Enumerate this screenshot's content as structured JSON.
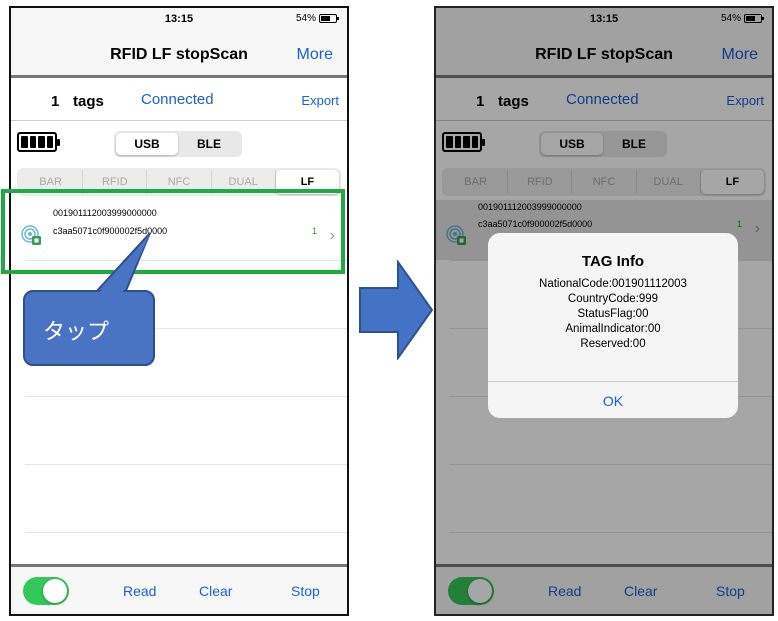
{
  "left_screen": {
    "status": {
      "time": "13:15",
      "battery": "54%"
    },
    "nav": {
      "title": "RFID LF stopScan",
      "more": "More"
    },
    "info": {
      "count": "1",
      "tags_label": "tags",
      "connection": "Connected",
      "export": "Export"
    },
    "connection_types": [
      {
        "label": "USB",
        "selected": true
      },
      {
        "label": "BLE",
        "selected": false
      }
    ],
    "modes": [
      {
        "label": "BAR"
      },
      {
        "label": "RFID"
      },
      {
        "label": "NFC"
      },
      {
        "label": "DUAL"
      },
      {
        "label": "LF",
        "selected": true
      }
    ],
    "tag": {
      "epc": "001901112003999000000",
      "tid": "c3aa5071c0f900002f5d0000",
      "count": "1"
    },
    "bottom": {
      "read": "Read",
      "clear": "Clear",
      "stop": "Stop"
    }
  },
  "annotation": {
    "callout_text": "タップ",
    "highlight_color": "#22a847",
    "callout_color": "#4b73c4",
    "arrow_color": "#4472c4"
  },
  "right_screen": {
    "status": {
      "time": "13:15",
      "battery": "54%"
    },
    "nav": {
      "title": "RFID LF stopScan",
      "more": "More"
    },
    "info": {
      "count": "1",
      "tags_label": "tags",
      "connection": "Connected",
      "export": "Export"
    },
    "connection_types": [
      {
        "label": "USB"
      },
      {
        "label": "BLE"
      }
    ],
    "modes": [
      {
        "label": "BAR"
      },
      {
        "label": "RFID"
      },
      {
        "label": "NFC"
      },
      {
        "label": "DUAL"
      },
      {
        "label": "LF",
        "selected": true
      }
    ],
    "tag": {
      "epc": "001901112003999000000",
      "tid": "c3aa5071c0f900002f5d0000",
      "count": "1"
    },
    "bottom": {
      "read": "Read",
      "clear": "Clear",
      "stop": "Stop"
    },
    "alert": {
      "title": "TAG Info",
      "lines": [
        "NationalCode:001901112003",
        "CountryCode:999",
        "StatusFlag:00",
        "AnimalIndicator:00",
        "Reserved:00"
      ],
      "ok": "OK"
    }
  },
  "icons": [
    "rfid-tag-icon",
    "chevron-right-icon",
    "battery-icon",
    "arrow-right-icon"
  ]
}
